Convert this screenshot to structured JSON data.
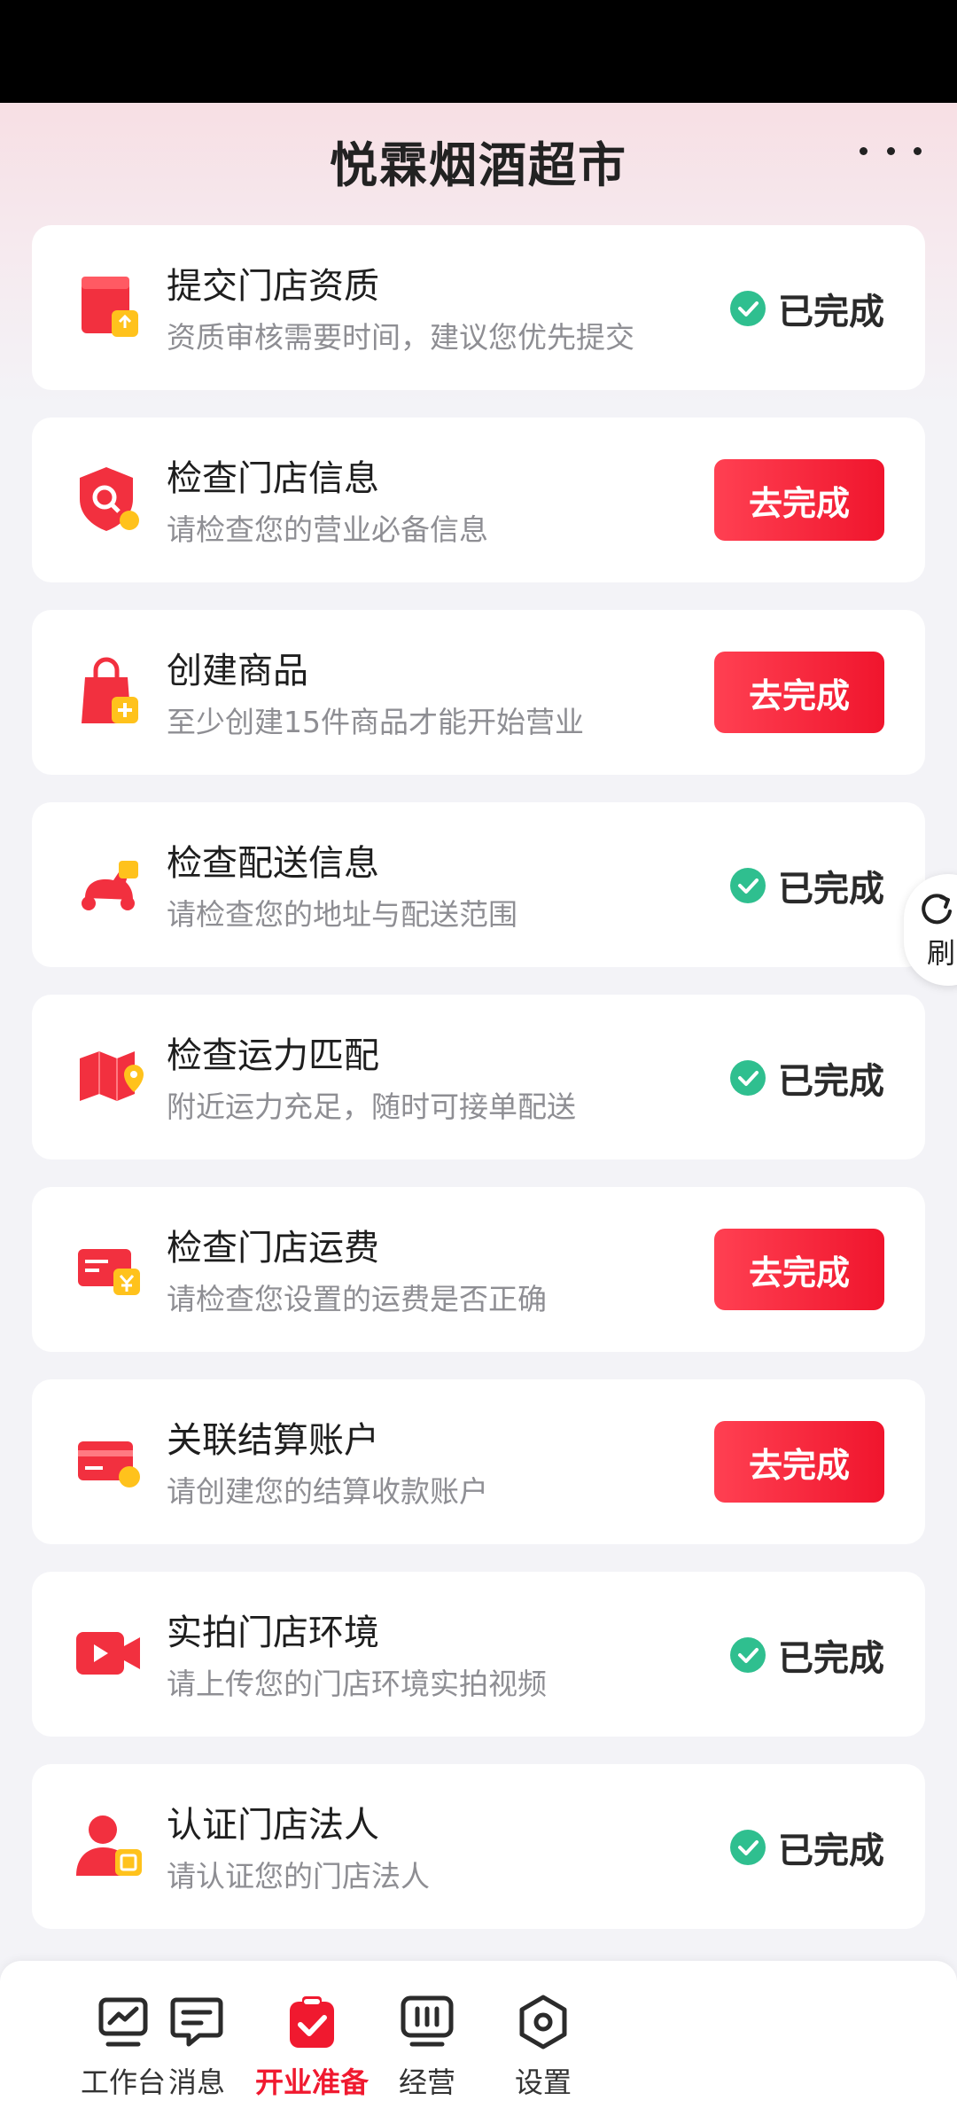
{
  "header": {
    "title": "悦霖烟酒超市"
  },
  "colors": {
    "accent": "#f0192f",
    "done_check": "#2fbf8f"
  },
  "tasks": [
    {
      "icon": "store-upload-icon",
      "title": "提交门店资质",
      "desc": "资质审核需要时间，建议您优先提交",
      "status": "done",
      "status_label": "已完成"
    },
    {
      "icon": "shield-search-icon",
      "title": "检查门店信息",
      "desc": "请检查您的营业必备信息",
      "status": "todo",
      "status_label": "去完成"
    },
    {
      "icon": "shopping-bag-add-icon",
      "title": "创建商品",
      "desc": "至少创建15件商品才能开始营业",
      "status": "todo",
      "status_label": "去完成"
    },
    {
      "icon": "scooter-icon",
      "title": "检查配送信息",
      "desc": "请检查您的地址与配送范围",
      "status": "done",
      "status_label": "已完成"
    },
    {
      "icon": "map-pin-icon",
      "title": "检查运力匹配",
      "desc": "附近运力充足，随时可接单配送",
      "status": "done",
      "status_label": "已完成"
    },
    {
      "icon": "yuan-card-icon",
      "title": "检查门店运费",
      "desc": "请检查您设置的运费是否正确",
      "status": "todo",
      "status_label": "去完成"
    },
    {
      "icon": "bank-card-icon",
      "title": "关联结算账户",
      "desc": "请创建您的结算收款账户",
      "status": "todo",
      "status_label": "去完成"
    },
    {
      "icon": "video-camera-icon",
      "title": "实拍门店环境",
      "desc": "请上传您的门店环境实拍视频",
      "status": "done",
      "status_label": "已完成"
    },
    {
      "icon": "person-id-icon",
      "title": "认证门店法人",
      "desc": "请认证您的门店法人",
      "status": "done",
      "status_label": "已完成"
    }
  ],
  "refresh": {
    "label": "刷"
  },
  "tabbar": [
    {
      "label": "工作台",
      "icon": "dashboard-chart-icon"
    },
    {
      "label": "消息",
      "icon": "message-bubble-icon"
    },
    {
      "label": "开业准备",
      "icon": "clipboard-check-icon",
      "active": true
    },
    {
      "label": "经营",
      "icon": "monitor-bars-icon"
    },
    {
      "label": "设置",
      "icon": "settings-hexagon-icon"
    }
  ]
}
